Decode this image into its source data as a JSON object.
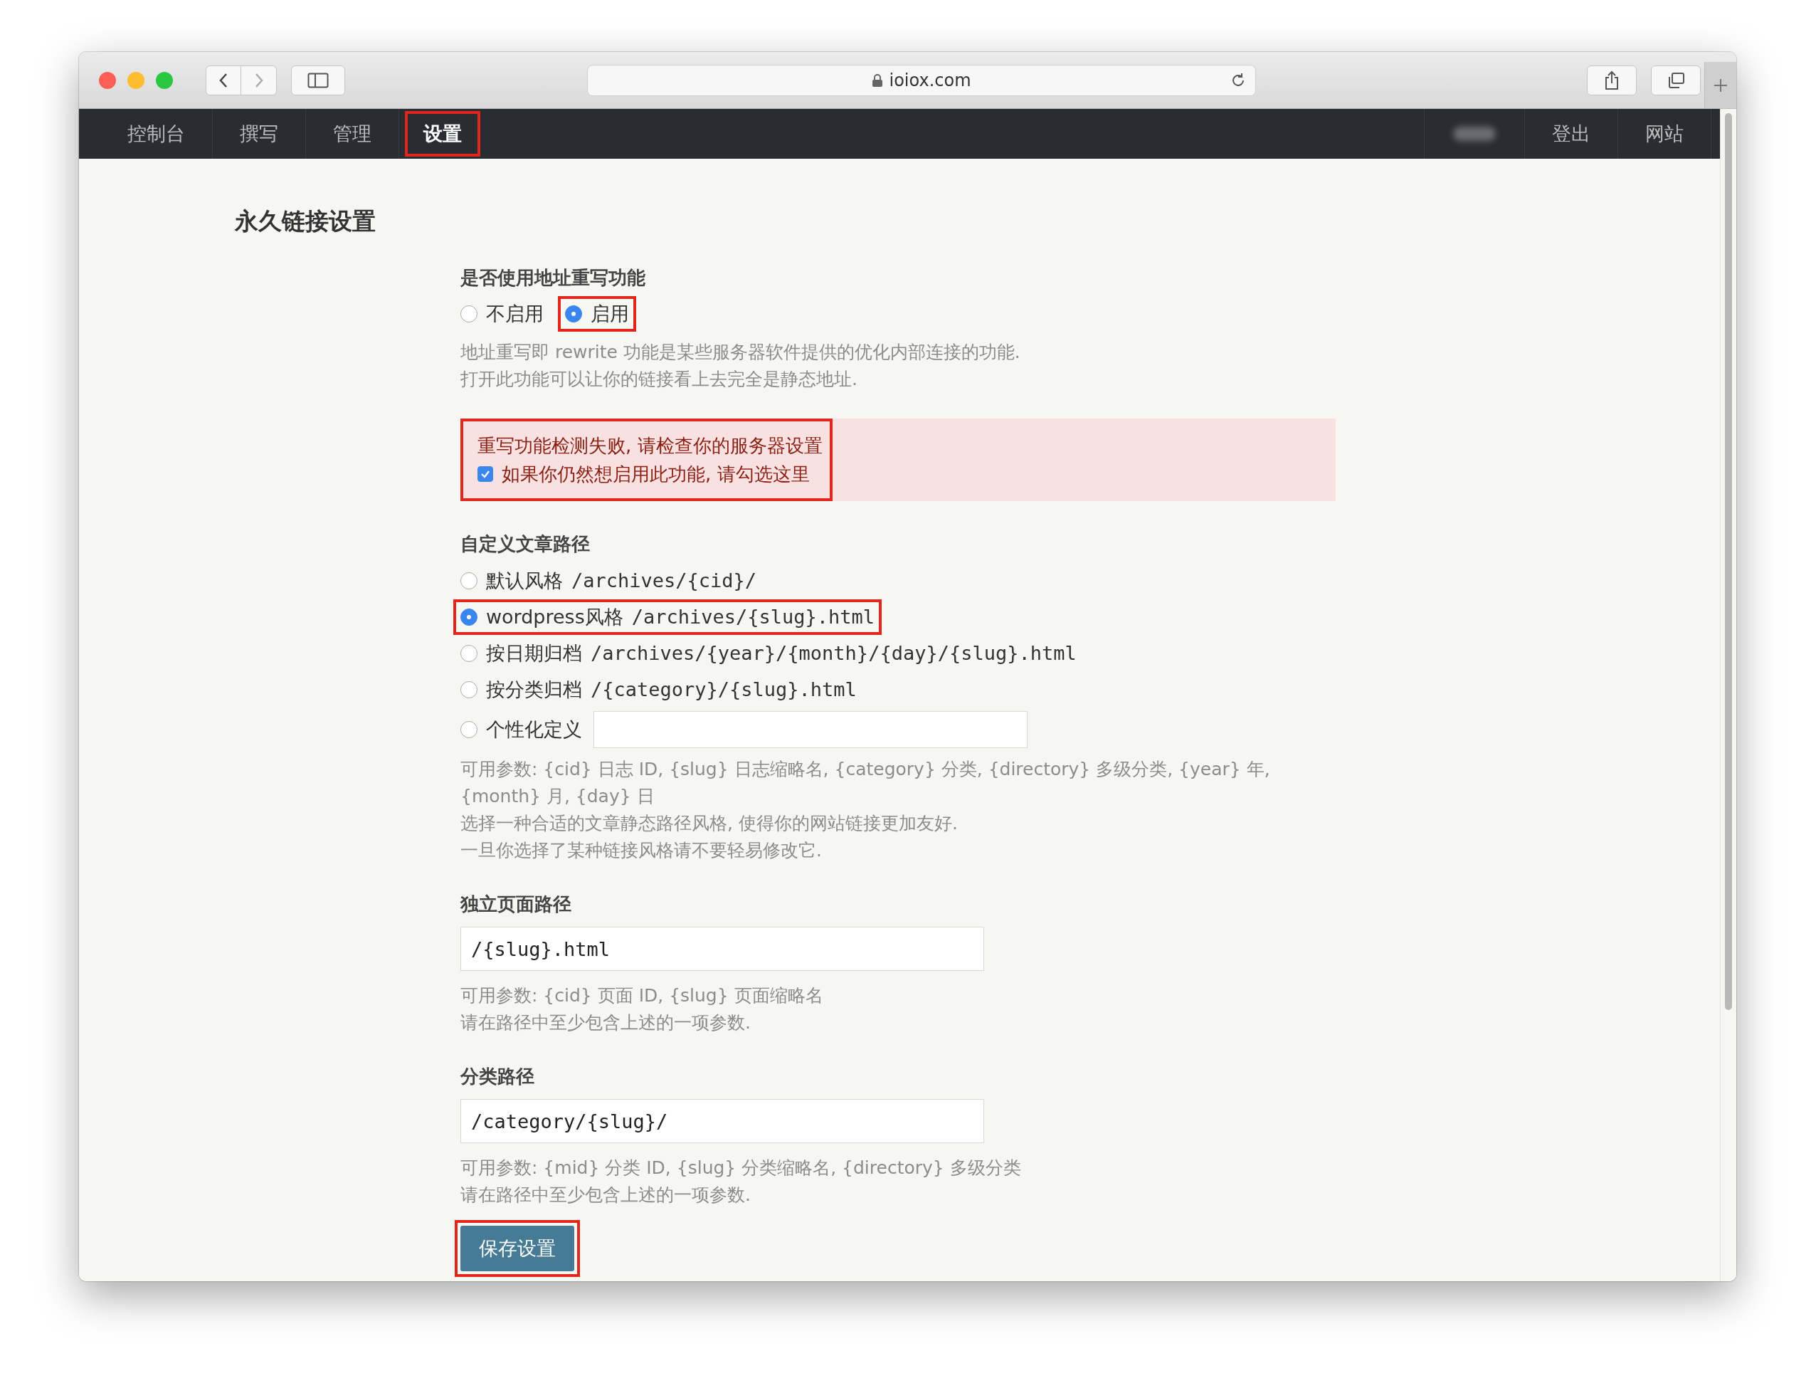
{
  "browser": {
    "url": "ioiox.com"
  },
  "nav": {
    "left": [
      {
        "label": "控制台",
        "selected": false,
        "highlighted": false
      },
      {
        "label": "撰写",
        "selected": false,
        "highlighted": false
      },
      {
        "label": "管理",
        "selected": false,
        "highlighted": false
      },
      {
        "label": "设置",
        "selected": true,
        "highlighted": true
      }
    ],
    "right": [
      {
        "label": "登出"
      },
      {
        "label": "网站"
      }
    ]
  },
  "page_title": "永久链接设置",
  "rewrite": {
    "label": "是否使用地址重写功能",
    "options": [
      {
        "label": "不启用",
        "selected": false,
        "highlighted": false
      },
      {
        "label": "启用",
        "selected": true,
        "highlighted": true
      }
    ],
    "help": [
      "地址重写即 rewrite 功能是某些服务器软件提供的优化内部连接的功能.",
      "打开此功能可以让你的链接看上去完全是静态地址."
    ]
  },
  "alert": {
    "highlighted": true,
    "message": "重写功能检测失败, 请检查你的服务器设置",
    "checkbox": {
      "label": "如果你仍然想启用此功能, 请勾选这里",
      "checked": true
    }
  },
  "post_path": {
    "label": "自定义文章路径",
    "options": [
      {
        "kind": "preset",
        "label": "默认风格",
        "path": "/archives/{cid}/",
        "selected": false,
        "highlighted": false
      },
      {
        "kind": "preset",
        "label": "wordpress风格",
        "path": "/archives/{slug}.html",
        "selected": true,
        "highlighted": true
      },
      {
        "kind": "preset",
        "label": "按日期归档",
        "path": "/archives/{year}/{month}/{day}/{slug}.html",
        "selected": false,
        "highlighted": false
      },
      {
        "kind": "preset",
        "label": "按分类归档",
        "path": "/{category}/{slug}.html",
        "selected": false,
        "highlighted": false
      },
      {
        "kind": "custom",
        "label": "个性化定义",
        "selected": false,
        "highlighted": false
      }
    ],
    "help": [
      "可用参数: {cid} 日志 ID, {slug} 日志缩略名, {category} 分类, {directory} 多级分类, {year} 年, {month} 月, {day} 日",
      "选择一种合适的文章静态路径风格, 使得你的网站链接更加友好.",
      "一旦你选择了某种链接风格请不要轻易修改它."
    ]
  },
  "page_path": {
    "label": "独立页面路径",
    "value": "/{slug}.html",
    "help": [
      "可用参数: {cid} 页面 ID, {slug} 页面缩略名",
      "请在路径中至少包含上述的一项参数."
    ]
  },
  "category_path": {
    "label": "分类路径",
    "value": "/category/{slug}/",
    "help": [
      "可用参数: {mid} 分类 ID, {slug} 分类缩略名, {directory} 多级分类",
      "请在路径中至少包含上述的一项参数."
    ]
  },
  "save_button": {
    "label": "保存设置",
    "highlighted": true
  }
}
